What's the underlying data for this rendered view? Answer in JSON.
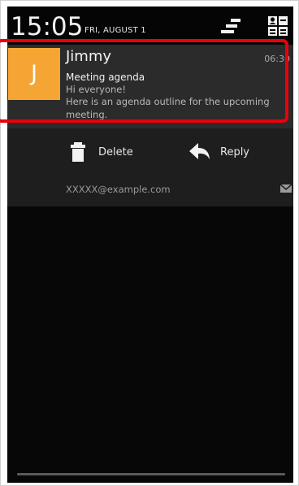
{
  "status_bar": {
    "time": "15:05",
    "date": "FRI, AUGUST 1",
    "clear_icon": "clear-all-icon",
    "settings_icon": "quick-settings-icon"
  },
  "notification": {
    "avatar_letter": "J",
    "avatar_color": "#f4a534",
    "sender": "Jimmy",
    "time": "06:30",
    "subject": "Meeting agenda",
    "body_lines": [
      "Hi everyone!",
      "Here is an agenda outline for the upcoming",
      "meeting."
    ],
    "highlight_color": "#e8000d"
  },
  "actions": {
    "delete": {
      "label": "Delete",
      "icon": "trash-icon"
    },
    "reply": {
      "label": "Reply",
      "icon": "reply-icon"
    },
    "account": "XXXXX@example.com",
    "account_icon": "mail-icon"
  }
}
